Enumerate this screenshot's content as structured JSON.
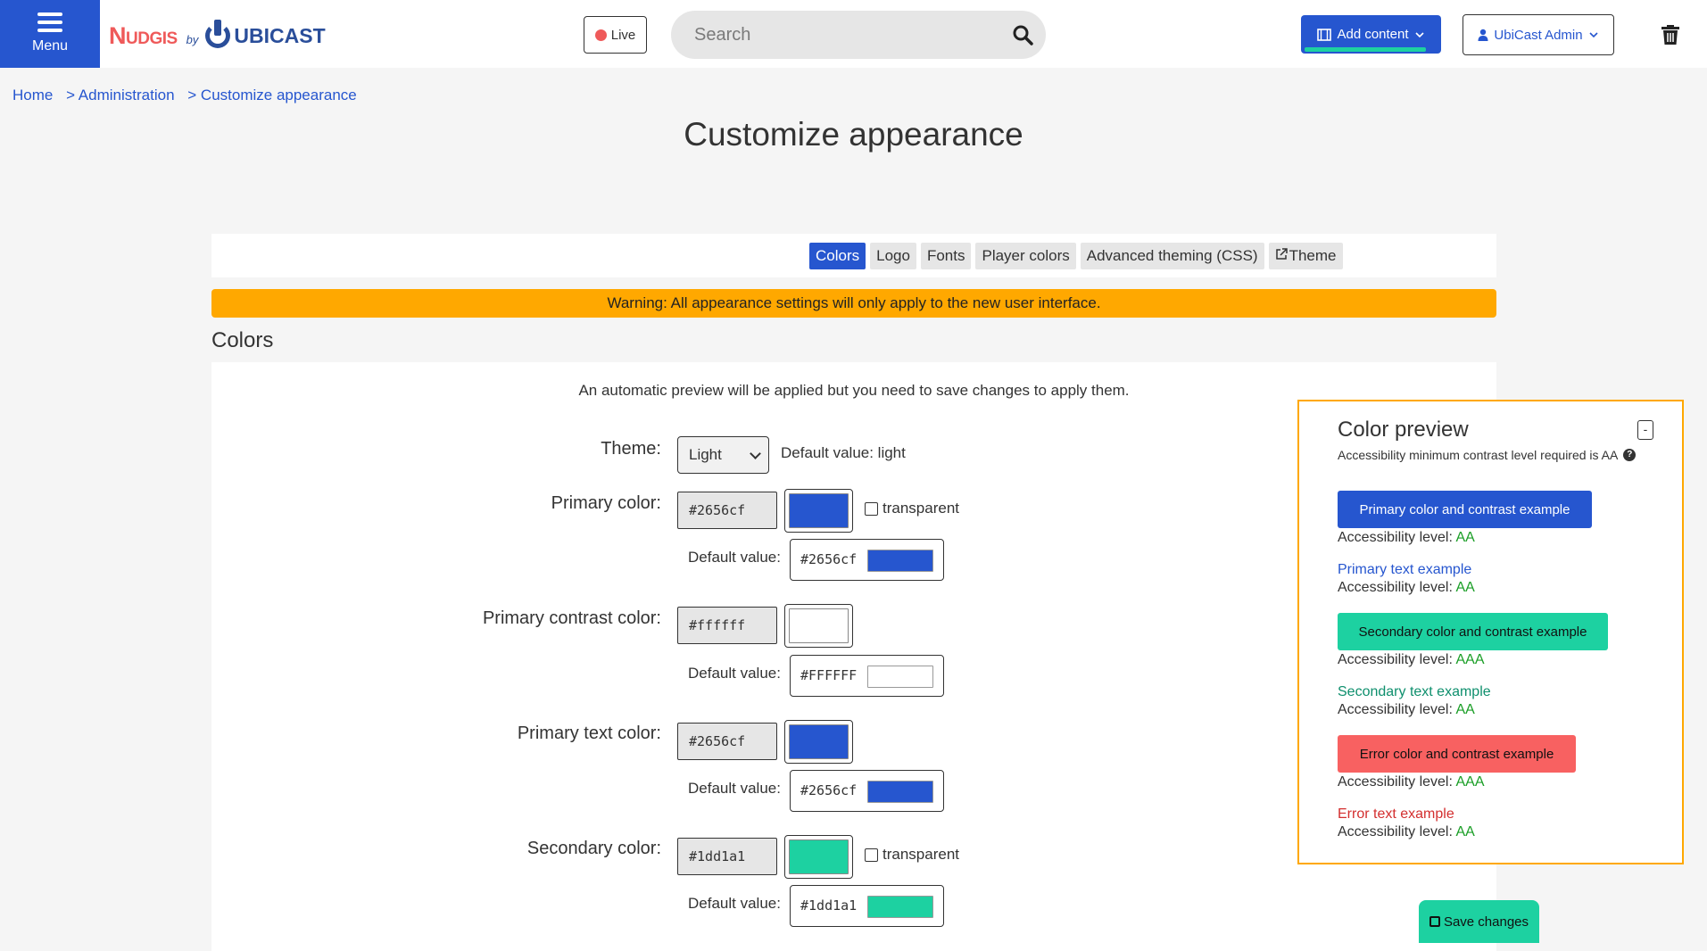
{
  "header": {
    "menu_label": "Menu",
    "logo_nudgis": "Nudgis",
    "logo_by": "by",
    "logo_ubicast": "UBICAST",
    "live_label": "Live",
    "search_placeholder": "Search",
    "add_content_label": "Add content",
    "admin_label": "UbiCast Admin"
  },
  "breadcrumb": [
    "Home",
    "> Administration",
    "> Customize appearance"
  ],
  "page_title": "Customize appearance",
  "tabs": [
    "Colors",
    "Logo",
    "Fonts",
    "Player colors",
    "Advanced theming (CSS)",
    "Theme"
  ],
  "warning": "Warning: All appearance settings will only apply to the new user interface.",
  "section_title": "Colors",
  "hint": "An automatic preview will be applied but you need to save changes to apply them.",
  "form": {
    "theme_label": "Theme:",
    "theme_value": "Light",
    "theme_default": "Default value: light",
    "transparent_label": "transparent",
    "default_value_label": "Default value:",
    "fields": [
      {
        "label": "Primary color:",
        "value": "#2656cf",
        "default": "#2656cf",
        "color": "#2656cf",
        "default_color": "#2656cf"
      },
      {
        "label": "Primary contrast color:",
        "value": "#ffffff",
        "default": "#FFFFFF",
        "color": "#ffffff",
        "default_color": "#ffffff"
      },
      {
        "label": "Primary text color:",
        "value": "#2656cf",
        "default": "#2656cf",
        "color": "#2656cf",
        "default_color": "#2656cf"
      },
      {
        "label": "Secondary color:",
        "value": "#1dd1a1",
        "default": "#1dd1a1",
        "color": "#1dd1a1",
        "default_color": "#1dd1a1"
      }
    ]
  },
  "preview": {
    "title": "Color preview",
    "toggle": "-",
    "subtitle": "Accessibility minimum contrast level required is AA",
    "level_label": "Accessibility level:",
    "primary_btn": "Primary color and contrast example",
    "primary_btn_level": "AA",
    "primary_text": "Primary text example",
    "primary_text_level": "AA",
    "secondary_btn": "Secondary color and contrast example",
    "secondary_btn_level": "AAA",
    "secondary_text": "Secondary text example",
    "secondary_text_level": "AA",
    "error_btn": "Error color and contrast example",
    "error_btn_level": "AAA",
    "error_text": "Error text example",
    "error_text_level": "AA"
  },
  "save_label": "Save changes",
  "colors": {
    "primary": "#2656cf",
    "secondary": "#1dd1a1",
    "error": "#f86161",
    "error_text": "#d32f2f",
    "secondary_text": "#0e8f6d",
    "warning": "#ffa800",
    "level": "#1a9e26"
  }
}
